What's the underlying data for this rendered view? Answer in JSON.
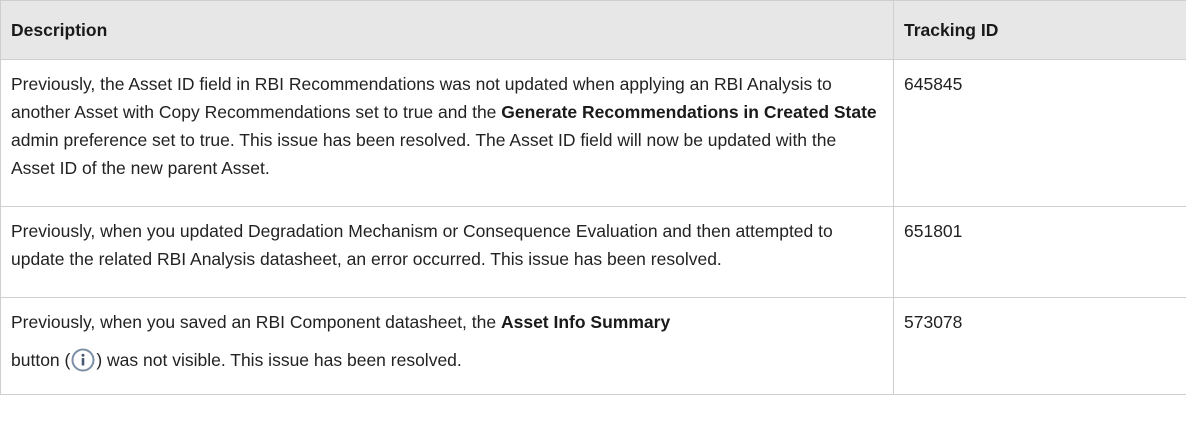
{
  "table": {
    "headers": {
      "description": "Description",
      "tracking_id": "Tracking ID"
    },
    "rows": [
      {
        "desc_pre": "Previously, the Asset ID field in RBI Recommendations was not updated when applying an RBI Analysis to another Asset with Copy Recommendations set to true and the ",
        "desc_bold": "Generate Recommendations in Created State",
        "desc_post": " admin preference set to true. This issue has been resolved. The Asset ID field will now be updated with the Asset ID of the new parent Asset.",
        "tracking_id": "645845"
      },
      {
        "desc": "Previously, when you updated Degradation Mechanism or Consequence Evaluation and then attempted to update the related RBI Analysis datasheet, an error occurred. This issue has been resolved.",
        "tracking_id": "651801"
      },
      {
        "desc_pre": "Previously, when you saved an RBI Component datasheet, the ",
        "desc_bold": "Asset Info Summary",
        "desc_button": "button (",
        "desc_icon": "info-icon",
        "desc_post": ") was not visible. This issue has been resolved.",
        "tracking_id": "573078"
      }
    ]
  }
}
